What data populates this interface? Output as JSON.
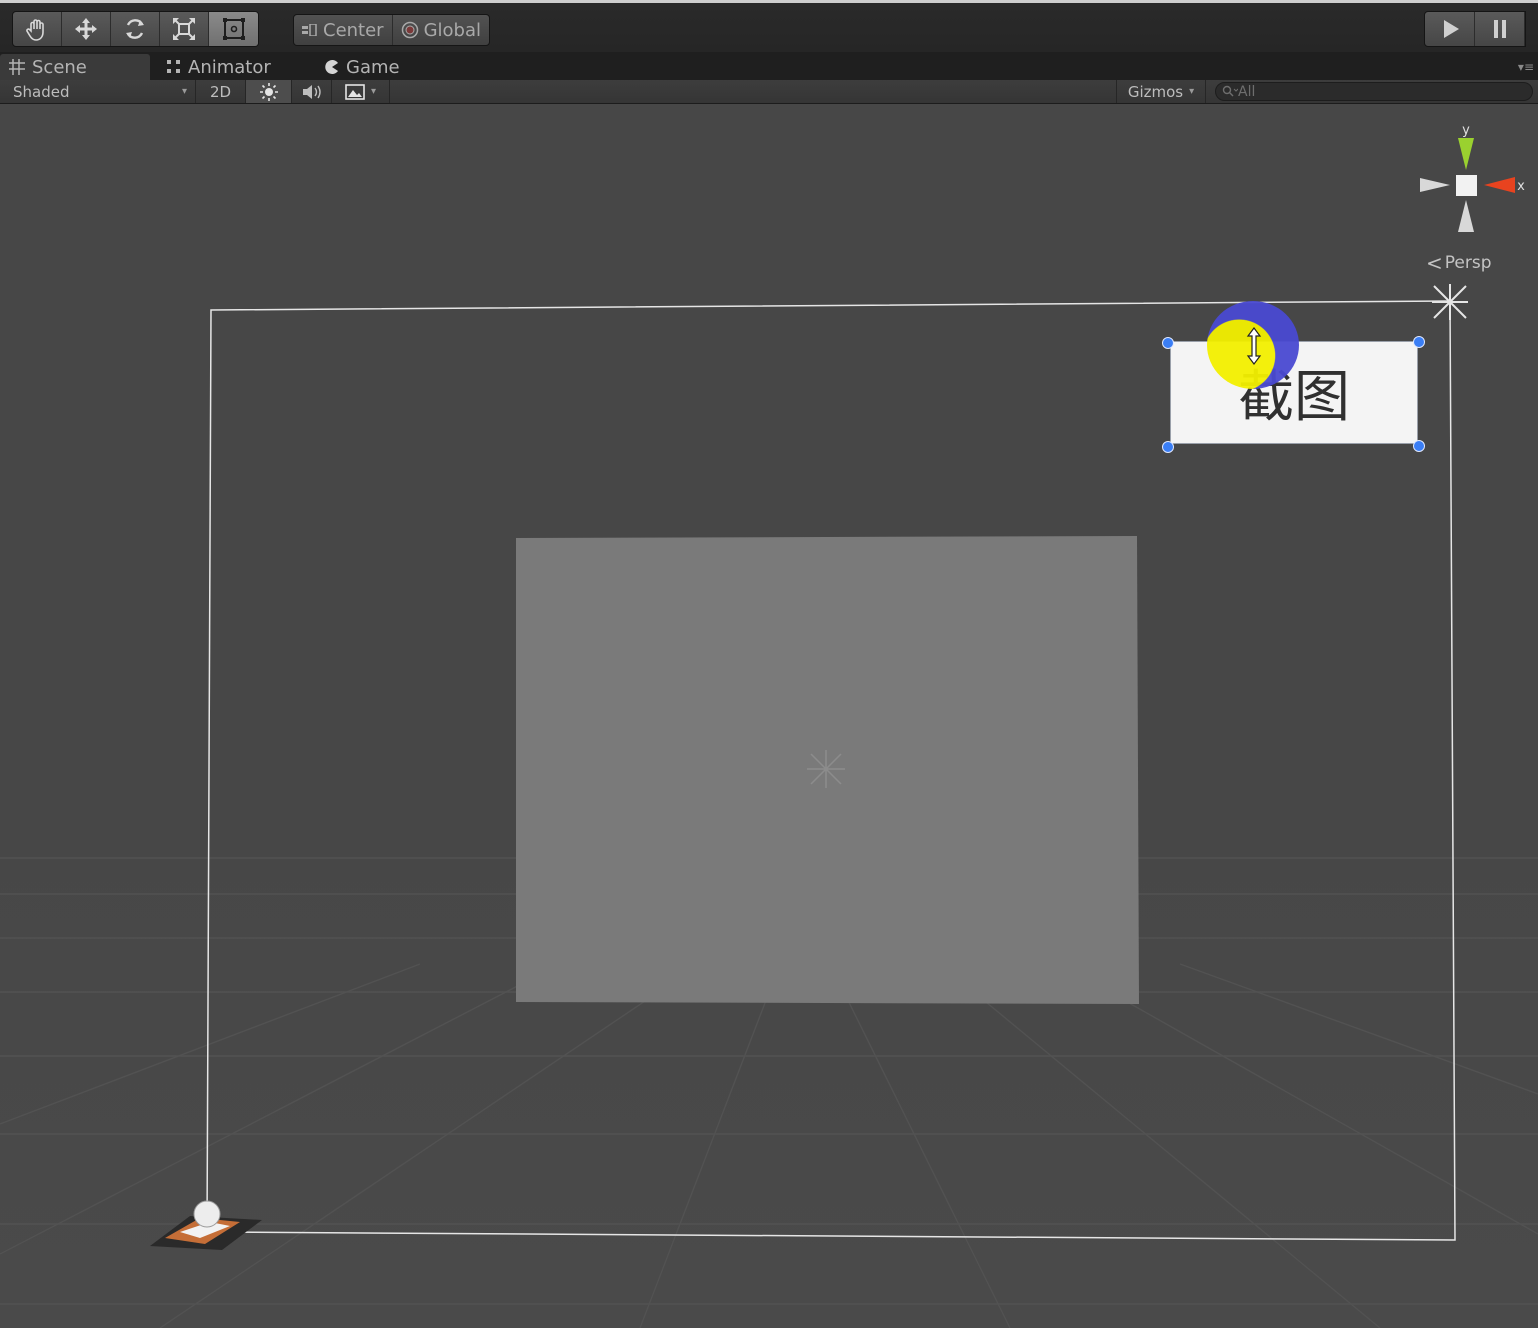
{
  "toolbar": {
    "tools": [
      {
        "name": "hand-tool",
        "icon": "hand-icon"
      },
      {
        "name": "move-tool",
        "icon": "move-icon"
      },
      {
        "name": "rotate-tool",
        "icon": "rotate-icon"
      },
      {
        "name": "scale-tool",
        "icon": "scale-icon"
      },
      {
        "name": "rect-tool",
        "icon": "rect-tool-icon",
        "active": true
      }
    ],
    "pivot_label": "Center",
    "space_label": "Global",
    "play_icon": "play-icon",
    "pause_icon": "pause-icon"
  },
  "tabs": {
    "scene": "Scene",
    "animator": "Animator",
    "game": "Game"
  },
  "scene_toolbar": {
    "draw_mode": "Shaded",
    "mode_2d": "2D",
    "gizmos": "Gizmos",
    "search_placeholder": "All"
  },
  "scene": {
    "axis_y": "y",
    "axis_x": "x",
    "projection": "Persp",
    "button_text": "截图"
  },
  "colors": {
    "axis_x": "#e8431f",
    "axis_y": "#9ad12f",
    "selection_handle": "#3a7ef5",
    "cursor_outer": "#4a4ad2",
    "cursor_inner": "#f3f000"
  }
}
